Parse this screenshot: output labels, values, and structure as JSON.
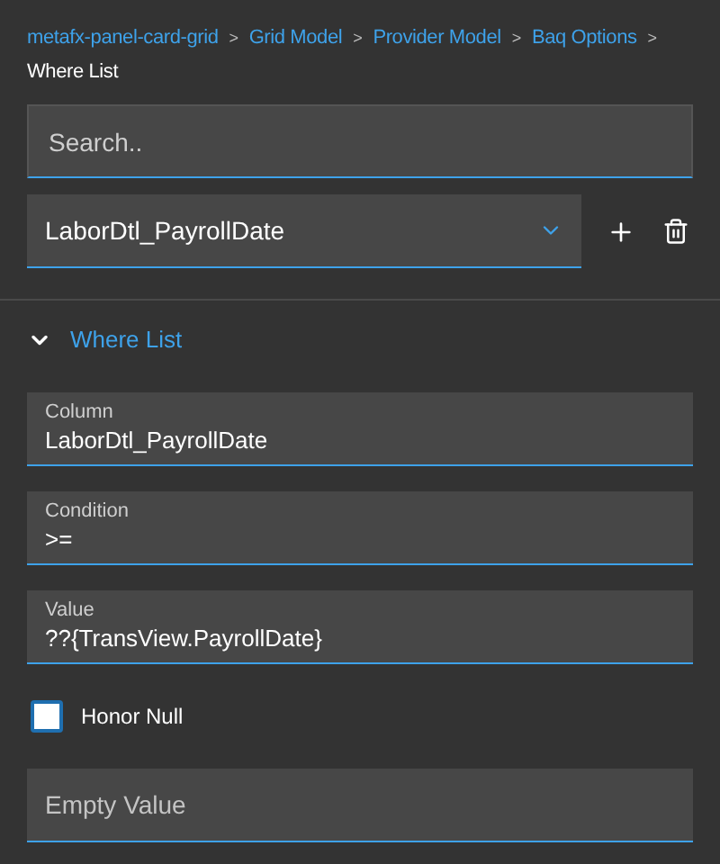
{
  "breadcrumb": {
    "separator": ">",
    "items": [
      {
        "label": "metafx-panel-card-grid",
        "current": false
      },
      {
        "label": "Grid Model",
        "current": false
      },
      {
        "label": "Provider Model",
        "current": false
      },
      {
        "label": "Baq Options",
        "current": false
      },
      {
        "label": "Where List",
        "current": true
      }
    ]
  },
  "search": {
    "placeholder": "Search.."
  },
  "selector": {
    "value": "LaborDtl_PayrollDate"
  },
  "section": {
    "title": "Where List",
    "expanded": true
  },
  "fields": [
    {
      "kind": "labeled",
      "label": "Column",
      "value": "LaborDtl_PayrollDate"
    },
    {
      "kind": "labeled",
      "label": "Condition",
      "value": ">="
    },
    {
      "kind": "labeled",
      "label": "Value",
      "value": "??{TransView.PayrollDate}"
    },
    {
      "kind": "checkbox",
      "label": "Honor Null",
      "checked": false
    },
    {
      "kind": "empty",
      "placeholder": "Empty Value"
    }
  ]
}
